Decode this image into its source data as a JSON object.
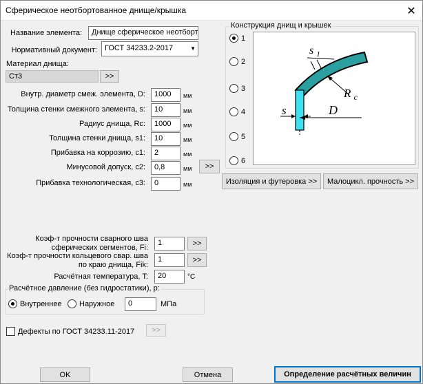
{
  "window": {
    "title": "Сферическое неотбортованное днище/крышка",
    "close_glyph": "✕"
  },
  "form": {
    "element_name": {
      "label": "Название элемента:",
      "value": "Днище сферическое неотборт"
    },
    "norm_doc": {
      "label": "Нормативный документ:",
      "value": "ГОСТ 34233.2-2017"
    },
    "material": {
      "label": "Материал днища:",
      "value": "Ст3",
      "button": ">>"
    },
    "fields": [
      {
        "label": "Внутр. диаметр смеж. элемента, D:",
        "value": "1000",
        "unit": "мм"
      },
      {
        "label": "Толщина стенки смежного элемента, s:",
        "value": "10",
        "unit": "мм"
      },
      {
        "label": "Радиус днища, Rc:",
        "value": "1000",
        "unit": "мм"
      },
      {
        "label": "Толщина стенки днища, s1:",
        "value": "10",
        "unit": "мм"
      },
      {
        "label": "Прибавка на коррозию, c1:",
        "value": "2",
        "unit": "мм"
      },
      {
        "label": "Минусовой допуск, c2:",
        "value": "0,8",
        "unit": "мм"
      },
      {
        "label": "Прибавка технологическая, c3:",
        "value": "0",
        "unit": "мм"
      }
    ],
    "c2_button": ">>",
    "fi": {
      "label_line1": "Коэф-т прочности сварного шва",
      "label_line2": "сферических сегментов, Fi:",
      "value": "1",
      "button": ">>"
    },
    "fik": {
      "label_line1": "Коэф-т прочности кольцевого свар. шва",
      "label_line2": "по краю днища, Fik:",
      "value": "1",
      "button": ">>"
    },
    "temperature": {
      "label": "Расчётная температура, T:",
      "value": "20",
      "unit": "°C"
    },
    "pressure": {
      "group_title": "Расчётное давление (без гидростатики), p:",
      "option_internal": "Внутреннее",
      "option_external": "Наружное",
      "selected": "internal",
      "value": "0",
      "unit": "МПа"
    },
    "defects": {
      "label": "Дефекты по ГОСТ 34233.11-2017",
      "checked": false,
      "button": ">>"
    }
  },
  "design": {
    "group_title": "Конструкция днищ и крышек",
    "options": [
      "1",
      "2",
      "3",
      "4",
      "5",
      "6"
    ],
    "selected_index": 0,
    "drawing_labels": {
      "s1": "s1",
      "rc": "Rc",
      "s": "s",
      "d": "D"
    }
  },
  "buttons": {
    "insulation": "Изоляция и футеровка >>",
    "lowcycle": "Малоцикл. прочность >>",
    "ok": "OK",
    "cancel": "Отмена",
    "determine": "Определение расчётных величин"
  },
  "colors": {
    "shell_teal": "#2aa0a0",
    "wall_cyan": "#40e0f0",
    "accent_button_border": "#0078d7"
  }
}
